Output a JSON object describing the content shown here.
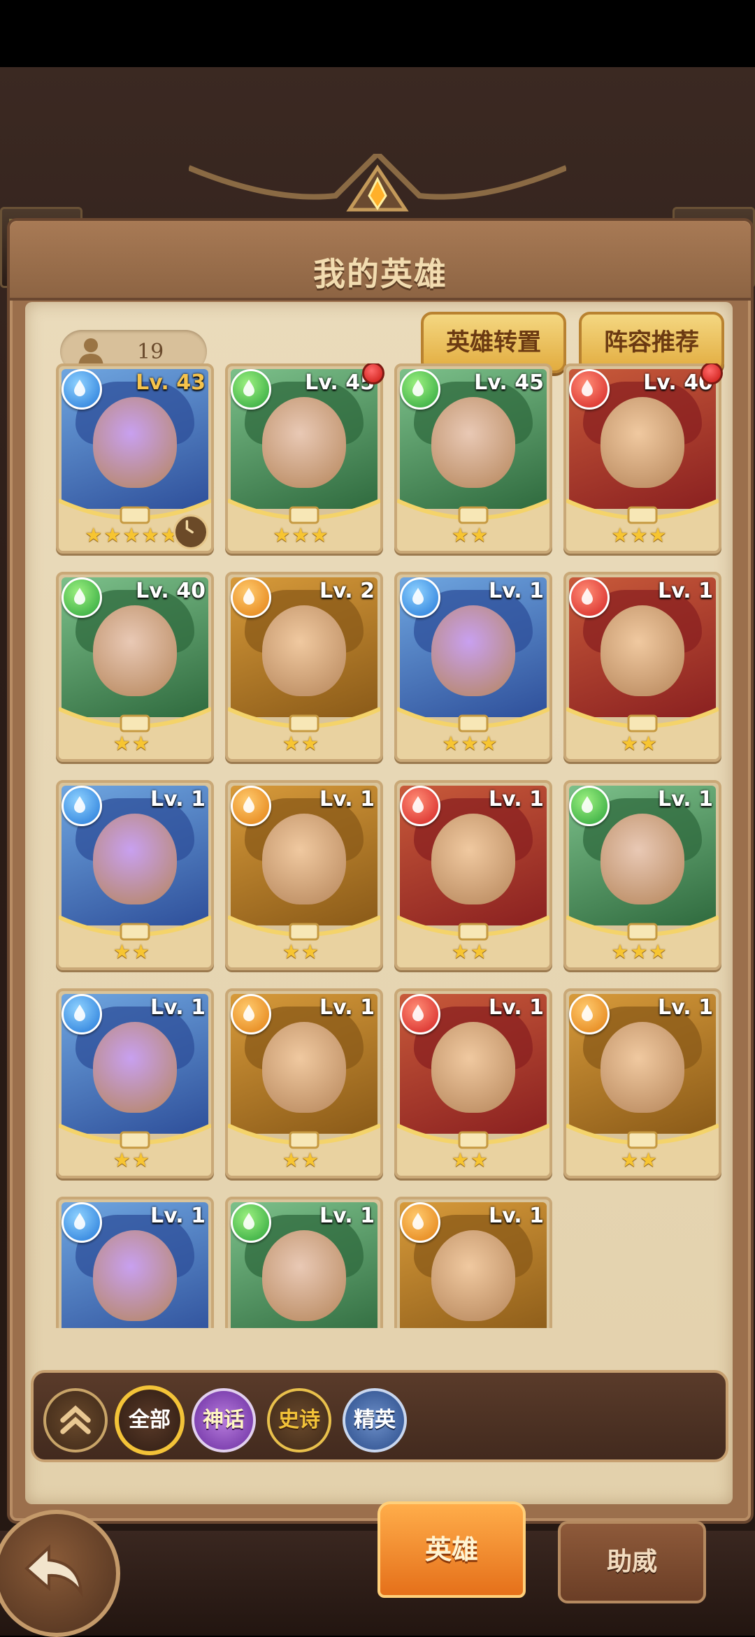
{
  "title": "我的英雄",
  "hero_count": "19",
  "buttons": {
    "transfer": "英雄转置",
    "recommend": "阵容推荐"
  },
  "heroes": [
    {
      "level": "Lv. 43",
      "element": "water",
      "stars": "★★★★★",
      "red_dot": false,
      "timer": true
    },
    {
      "level": "Lv. 45",
      "element": "wind",
      "stars": "★★★",
      "red_dot": true,
      "timer": false
    },
    {
      "level": "Lv. 45",
      "element": "wind",
      "stars": "★★",
      "red_dot": false,
      "timer": false
    },
    {
      "level": "Lv. 40",
      "element": "fire",
      "stars": "★★★",
      "red_dot": true,
      "timer": false
    },
    {
      "level": "Lv. 40",
      "element": "wind",
      "stars": "★★",
      "red_dot": false,
      "timer": false
    },
    {
      "level": "Lv. 2",
      "element": "earth",
      "stars": "★★",
      "red_dot": false,
      "timer": false
    },
    {
      "level": "Lv. 1",
      "element": "water",
      "stars": "★★★",
      "red_dot": false,
      "timer": false
    },
    {
      "level": "Lv. 1",
      "element": "fire",
      "stars": "★★",
      "red_dot": false,
      "timer": false
    },
    {
      "level": "Lv. 1",
      "element": "water",
      "stars": "★★",
      "red_dot": false,
      "timer": false
    },
    {
      "level": "Lv. 1",
      "element": "earth",
      "stars": "★★",
      "red_dot": false,
      "timer": false
    },
    {
      "level": "Lv. 1",
      "element": "fire",
      "stars": "★★",
      "red_dot": false,
      "timer": false
    },
    {
      "level": "Lv. 1",
      "element": "wind",
      "stars": "★★★",
      "red_dot": false,
      "timer": false
    },
    {
      "level": "Lv. 1",
      "element": "water",
      "stars": "★★",
      "red_dot": false,
      "timer": false
    },
    {
      "level": "Lv. 1",
      "element": "earth",
      "stars": "★★",
      "red_dot": false,
      "timer": false
    },
    {
      "level": "Lv. 1",
      "element": "fire",
      "stars": "★★",
      "red_dot": false,
      "timer": false
    },
    {
      "level": "Lv. 1",
      "element": "earth",
      "stars": "★★",
      "red_dot": false,
      "timer": false
    },
    {
      "level": "Lv. 1",
      "element": "water",
      "stars": "",
      "red_dot": false,
      "timer": false
    },
    {
      "level": "Lv. 1",
      "element": "wind",
      "stars": "",
      "red_dot": false,
      "timer": false
    },
    {
      "level": "Lv. 1",
      "element": "earth",
      "stars": "",
      "red_dot": false,
      "timer": false
    }
  ],
  "filters": {
    "all": "全部",
    "myth": "神话",
    "epic": "史诗",
    "elite": "精英"
  },
  "tabs": {
    "hero": "英雄",
    "cheer": "助威"
  },
  "colors": {
    "water": "#2277d8",
    "wind": "#2aa33a",
    "fire": "#d42222",
    "earth": "#e27f12",
    "accent_gold": "#f3c338"
  }
}
